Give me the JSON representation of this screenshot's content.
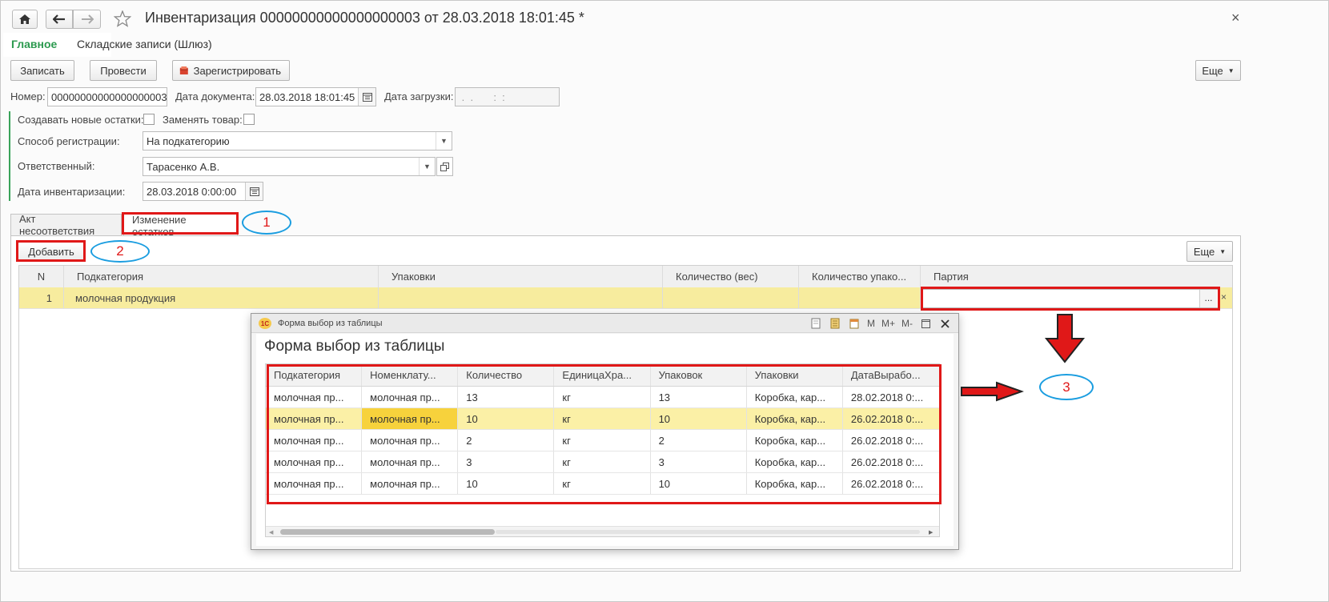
{
  "window": {
    "title": "Инвентаризация 00000000000000000003 от 28.03.2018 18:01:45 *",
    "close_glyph": "×"
  },
  "nav": {
    "home_icon": "home-icon",
    "back_icon": "arrow-left-icon",
    "forward_icon": "arrow-right-icon",
    "favorite_icon": "star-icon"
  },
  "sections": {
    "main": "Главное",
    "warehouse": "Складские записи (Шлюз)"
  },
  "toolbar": {
    "write": "Записать",
    "post": "Провести",
    "register": "Зарегистрировать",
    "more": "Еще"
  },
  "header_fields": {
    "number_label": "Номер:",
    "number_value": "00000000000000000003",
    "doc_date_label": "Дата документа:",
    "doc_date_value": "28.03.2018 18:01:45",
    "load_date_label": "Дата загрузки:",
    "load_date_value": " .  .       :  :"
  },
  "options": {
    "create_new_label": "Создавать новые остатки:",
    "replace_goods_label": "Заменять товар:",
    "reg_method_label": "Способ регистрации:",
    "reg_method_value": "На подкатегорию",
    "responsible_label": "Ответственный:",
    "responsible_value": "Тарасенко А.В.",
    "inv_date_label": "Дата инвентаризации:",
    "inv_date_value": "28.03.2018  0:00:00"
  },
  "tabs": {
    "act": "Акт несоответствия",
    "change": "Изменение остатков"
  },
  "table_toolbar": {
    "add": "Добавить",
    "more": "Еще"
  },
  "table": {
    "columns": [
      "N",
      "Подкатегория",
      "Упаковки",
      "Количество (вес)",
      "Количество упако...",
      "Партия"
    ],
    "rows": [
      [
        "1",
        "молочная продукция",
        "",
        "",
        "",
        ""
      ]
    ],
    "ellipsis": "...",
    "clear": "×"
  },
  "dialog": {
    "caption": "Форма выбор из таблицы",
    "title": "Форма выбор из таблицы",
    "logo_text": "1С",
    "caption_buttons": [
      "M",
      "M+",
      "M-"
    ],
    "columns": [
      "Подкатегория",
      "Номенклату...",
      "Количество",
      "ЕдиницаХра...",
      "Упаковок",
      "Упаковки",
      "ДатаВырабо..."
    ],
    "rows": [
      [
        "молочная пр...",
        "молочная пр...",
        "13",
        "кг",
        "13",
        "Коробка, кар...",
        "28.02.2018 0:..."
      ],
      [
        "молочная пр...",
        "молочная пр...",
        "10",
        "кг",
        "10",
        "Коробка, кар...",
        "26.02.2018 0:..."
      ],
      [
        "молочная пр...",
        "молочная пр...",
        "2",
        "кг",
        "2",
        "Коробка, кар...",
        "26.02.2018 0:..."
      ],
      [
        "молочная пр...",
        "молочная пр...",
        "3",
        "кг",
        "3",
        "Коробка, кар...",
        "26.02.2018 0:..."
      ],
      [
        "молочная пр...",
        "молочная пр...",
        "10",
        "кг",
        "10",
        "Коробка, кар...",
        "26.02.2018 0:..."
      ]
    ],
    "selected_row": 1
  },
  "annotations": {
    "one": "1",
    "two": "2",
    "three": "3",
    "highlight_color": "#e01818",
    "ellipse_color": "#1a9de0"
  }
}
